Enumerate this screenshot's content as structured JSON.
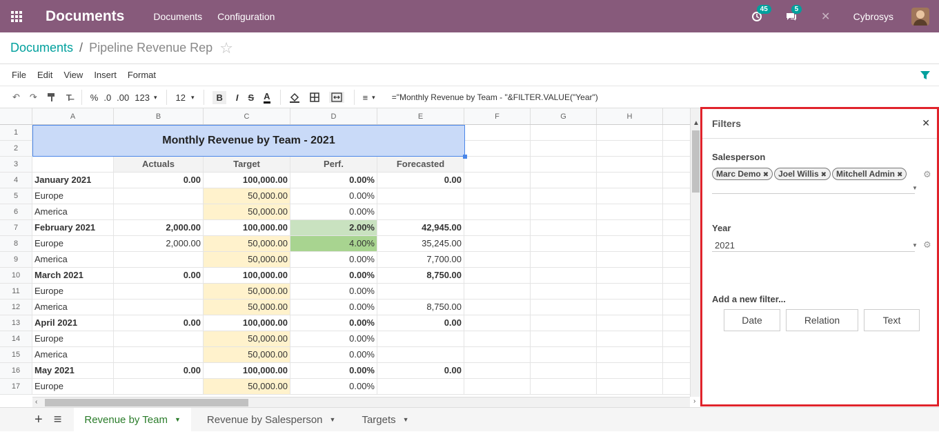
{
  "navbar": {
    "brand": "Documents",
    "menus": [
      "Documents",
      "Configuration"
    ],
    "activity_count": "45",
    "messages_count": "5",
    "company": "Cybrosys"
  },
  "breadcrumb": {
    "parent": "Documents",
    "separator": "/",
    "current": "Pipeline Revenue Rep"
  },
  "menubar": [
    "File",
    "Edit",
    "View",
    "Insert",
    "Format"
  ],
  "toolbar": {
    "percent": "%",
    "dec_less": ".0",
    "dec_more": ".00",
    "format": "123",
    "font_size": "12",
    "formula": "=\"Monthly Revenue by Team - \"&FILTER.VALUE(\"Year\")"
  },
  "sheet": {
    "columns": [
      "A",
      "B",
      "C",
      "D",
      "E",
      "F",
      "G",
      "H"
    ],
    "title": "Monthly Revenue by Team - 2021",
    "rows": [
      {
        "n": "1",
        "cells": [
          "",
          "",
          "",
          "",
          ""
        ]
      },
      {
        "n": "2",
        "cells": [
          "",
          "",
          "",
          "",
          ""
        ]
      },
      {
        "n": "3",
        "cells": [
          "",
          "Actuals",
          "Target",
          "Perf.",
          "Forecasted"
        ]
      },
      {
        "n": "4",
        "cells": [
          "January 2021",
          "0.00",
          "100,000.00",
          "0.00%",
          "0.00"
        ]
      },
      {
        "n": "5",
        "cells": [
          "Europe",
          "",
          "50,000.00",
          "0.00%",
          ""
        ]
      },
      {
        "n": "6",
        "cells": [
          "America",
          "",
          "50,000.00",
          "0.00%",
          ""
        ]
      },
      {
        "n": "7",
        "cells": [
          "February 2021",
          "2,000.00",
          "100,000.00",
          "2.00%",
          "42,945.00"
        ]
      },
      {
        "n": "8",
        "cells": [
          "Europe",
          "2,000.00",
          "50,000.00",
          "4.00%",
          "35,245.00"
        ]
      },
      {
        "n": "9",
        "cells": [
          "America",
          "",
          "50,000.00",
          "0.00%",
          "7,700.00"
        ]
      },
      {
        "n": "10",
        "cells": [
          "March 2021",
          "0.00",
          "100,000.00",
          "0.00%",
          "8,750.00"
        ]
      },
      {
        "n": "11",
        "cells": [
          "Europe",
          "",
          "50,000.00",
          "0.00%",
          ""
        ]
      },
      {
        "n": "12",
        "cells": [
          "America",
          "",
          "50,000.00",
          "0.00%",
          "8,750.00"
        ]
      },
      {
        "n": "13",
        "cells": [
          "April 2021",
          "0.00",
          "100,000.00",
          "0.00%",
          "0.00"
        ]
      },
      {
        "n": "14",
        "cells": [
          "Europe",
          "",
          "50,000.00",
          "0.00%",
          ""
        ]
      },
      {
        "n": "15",
        "cells": [
          "America",
          "",
          "50,000.00",
          "0.00%",
          ""
        ]
      },
      {
        "n": "16",
        "cells": [
          "May 2021",
          "0.00",
          "100,000.00",
          "0.00%",
          "0.00"
        ]
      },
      {
        "n": "17",
        "cells": [
          "Europe",
          "",
          "50,000.00",
          "0.00%",
          ""
        ]
      }
    ]
  },
  "tabs": [
    "Revenue by Team",
    "Revenue by Salesperson",
    "Targets"
  ],
  "filters": {
    "title": "Filters",
    "salesperson_label": "Salesperson",
    "salespersons": [
      "Marc Demo",
      "Joel Willis",
      "Mitchell Admin"
    ],
    "year_label": "Year",
    "year_value": "2021",
    "add_label": "Add a new filter...",
    "buttons": [
      "Date",
      "Relation",
      "Text"
    ]
  },
  "colors": {
    "navbar": "#875a7b",
    "accent": "#00a09d",
    "highlight_border": "#e0232b"
  }
}
